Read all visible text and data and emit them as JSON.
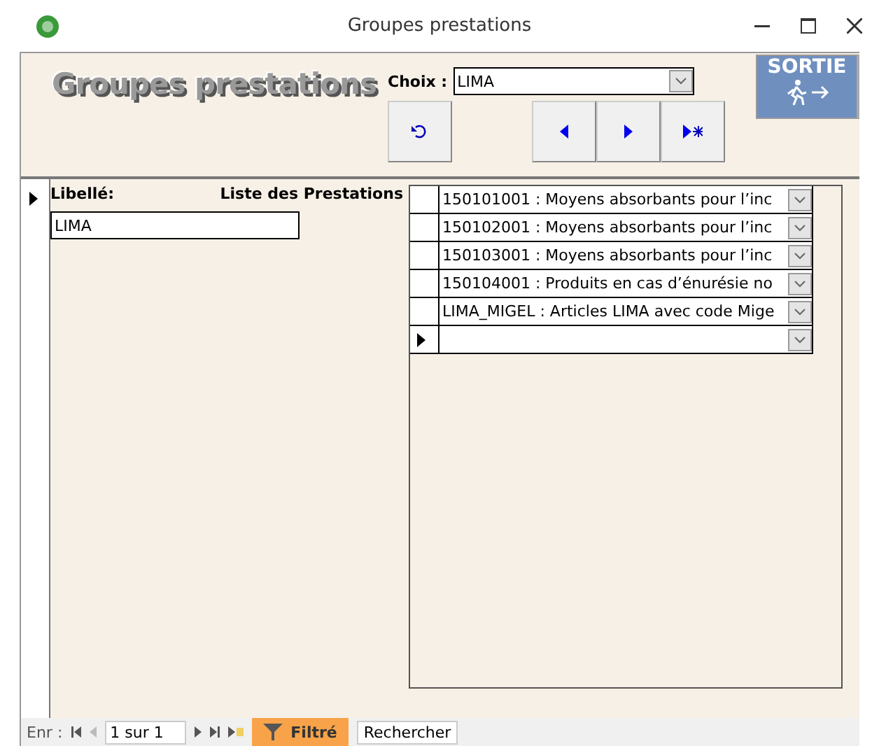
{
  "window": {
    "title": "Groupes prestations"
  },
  "header": {
    "title": "Groupes prestations",
    "choice_label": "Choix :",
    "choice_value": "LIMA",
    "exit_button": "SORTIE"
  },
  "detail": {
    "label_caption": "Libellé:",
    "label_value": "LIMA",
    "list_caption": "Liste des Prestations"
  },
  "prestations": [
    {
      "text": "150101001 : Moyens absorbants pour l’inc"
    },
    {
      "text": "150102001 : Moyens absorbants pour l’inc"
    },
    {
      "text": "150103001 : Moyens absorbants pour l’inc"
    },
    {
      "text": "150104001 : Produits en cas d’énurésie no"
    },
    {
      "text": "LIMA_MIGEL : Articles LIMA avec code Mige"
    }
  ],
  "navigation": {
    "label": "Enr :",
    "position": "1 sur 1",
    "filter": "Filtré",
    "search": "Rechercher"
  }
}
